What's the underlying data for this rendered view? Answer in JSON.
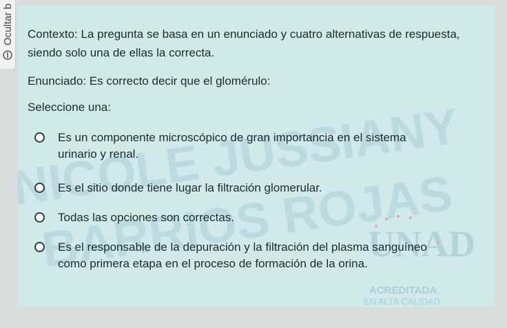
{
  "side_tab": {
    "label": "Ocultar b",
    "icon": "collapse-icon"
  },
  "question": {
    "context": "Contexto: La pregunta se basa en un enunciado y cuatro alternativas de respuesta, siendo solo una de ellas la correcta.",
    "statement": "Enunciado: Es correcto decir que el glomérulo:",
    "select_label": "Seleccione una:",
    "options": [
      {
        "label": "Es un componente microscópico de gran importancia en el sistema urinario y renal.",
        "selected": false
      },
      {
        "label": "Es el sitio donde tiene lugar la filtración glomerular.",
        "selected": false
      },
      {
        "label": "Todas las opciones son correctas.",
        "selected": false
      },
      {
        "label": "Es el responsable de la depuración y la filtración del plasma sanguíneo como primera etapa en el proceso de formación de la orina.",
        "selected": false
      }
    ]
  },
  "watermark": {
    "line1": "NICOLE JUSSIANY",
    "line2": "BARRIOS ROJAS"
  },
  "logo": {
    "name": "UNAD",
    "tagline": "ACREDITADA",
    "subtagline": "EN ALTA CALIDAD"
  },
  "colors": {
    "panel_bg": "#d2e9ec",
    "page_bg": "#d9dcdc",
    "text": "#1d2a2d",
    "watermark": "#a9ced5",
    "logo_accent": "#e8a7a7"
  }
}
